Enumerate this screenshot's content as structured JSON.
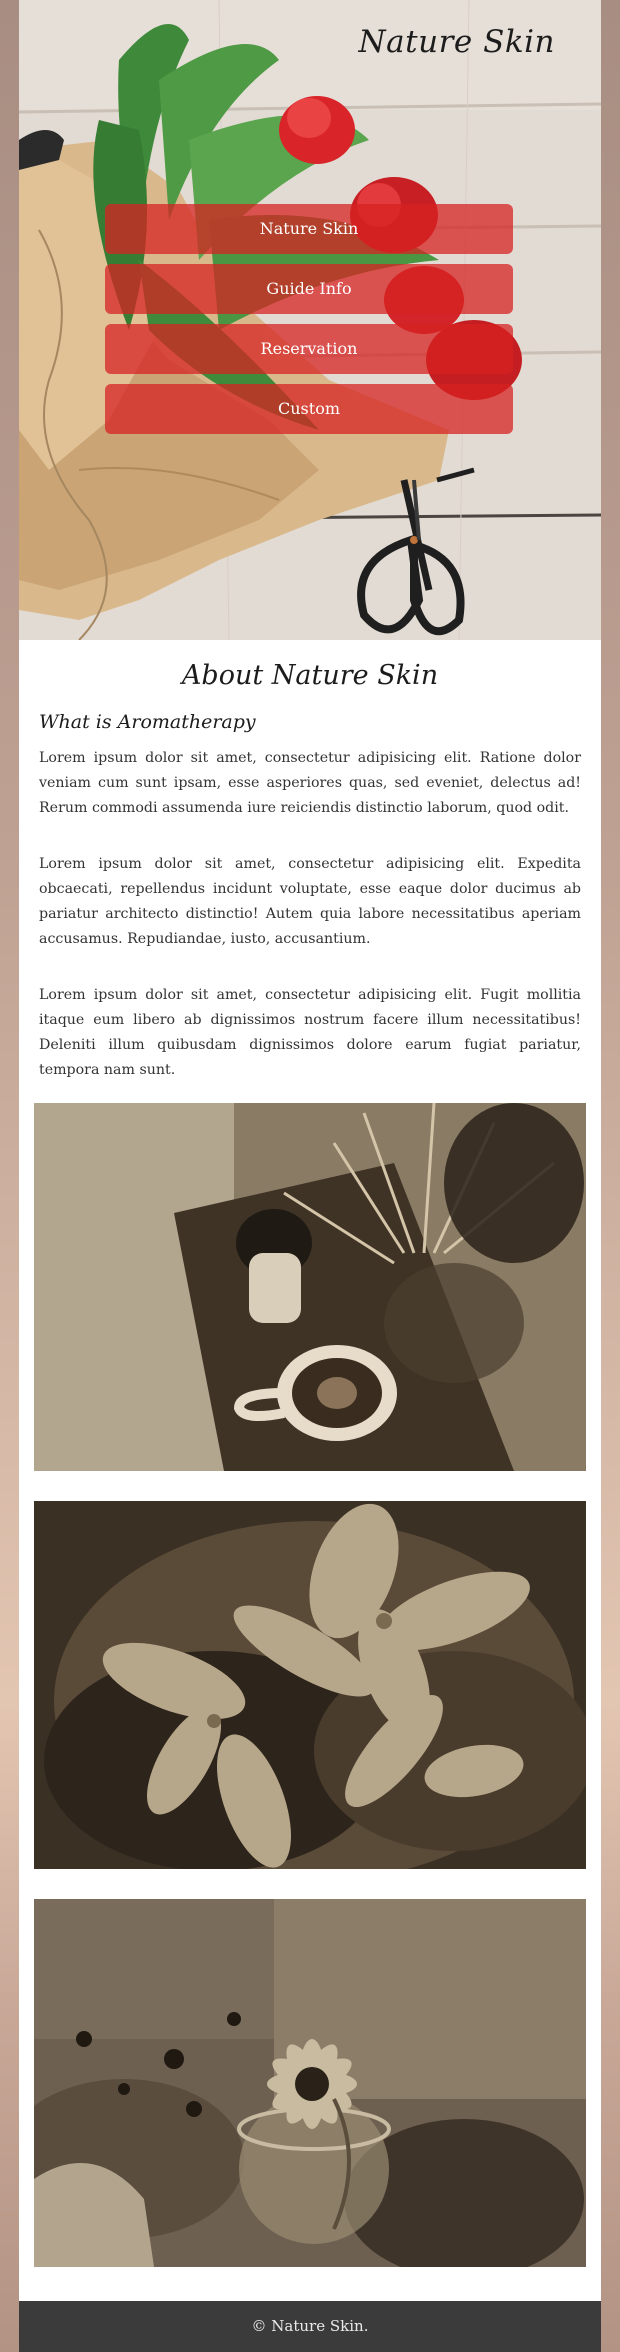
{
  "header": {
    "brand": "Nature Skin"
  },
  "nav": {
    "items": [
      {
        "label": "Nature Skin"
      },
      {
        "label": "Guide Info"
      },
      {
        "label": "Reservation"
      },
      {
        "label": "Custom"
      }
    ]
  },
  "about": {
    "title": "About Nature Skin",
    "subtitle": "What is Aromatherapy",
    "paragraphs": [
      "Lorem ipsum dolor sit amet, consectetur adipisicing elit. Ratione dolor veniam cum sunt ipsam, esse asperiores quas, sed eveniet, delectus ad! Rerum commodi assumenda iure reiciendis distinctio laborum, quod odit.",
      "Lorem ipsum dolor sit amet, consectetur adipisicing elit. Expedita obcaecati, repellendus incidunt voluptate, esse eaque dolor ducimus ab pariatur architecto distinctio! Autem quia labore necessitatibus aperiam accusamus. Repudiandae, iusto, accusantium.",
      "Lorem ipsum dolor sit amet, consectetur adipisicing elit. Fugit mollitia itaque eum libero ab dignissimos nostrum facere illum necessitatibus! Deleniti illum quibusdam dignissimos dolore earum fugiat pariatur, tempora nam sunt."
    ]
  },
  "footer": {
    "copyright": "© Nature Skin."
  },
  "colors": {
    "nav_button": "#d62222",
    "footer_bg": "#3b3b3b",
    "photo_tone": "#6b5e4b"
  }
}
